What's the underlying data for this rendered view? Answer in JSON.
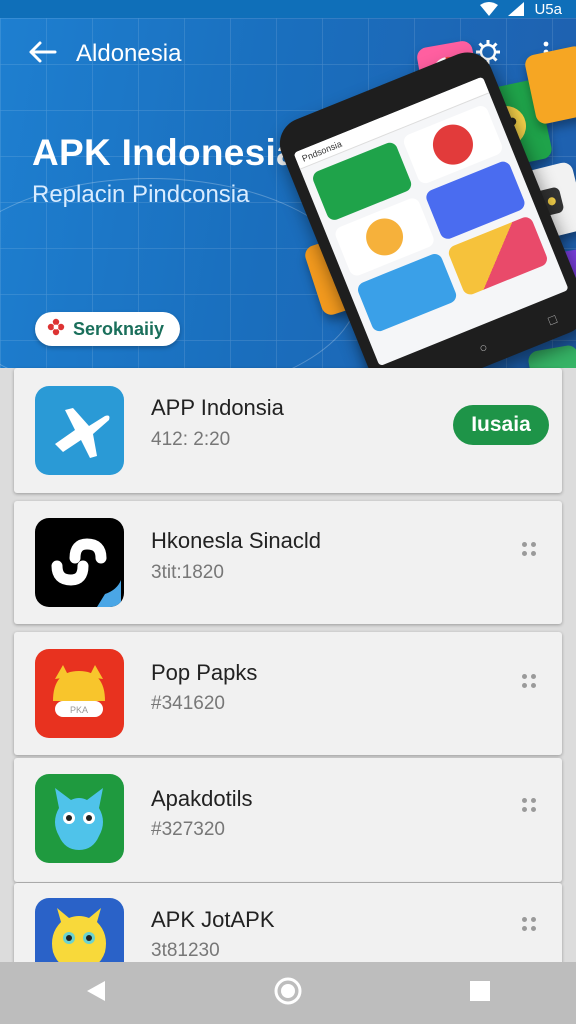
{
  "status_bar": {
    "carrier_text": "U5a"
  },
  "appbar": {
    "title": "Aldonesia"
  },
  "hero": {
    "title": "APK Indonesia",
    "subtitle": "Replacin Pindconsia",
    "chip_label": "Seroknaiiy",
    "phone_header": "Pndsonsia"
  },
  "apps": [
    {
      "name": "APP Indonsia",
      "meta": "412: 2:20",
      "action": "Iusaia",
      "icon": "airplane-icon"
    },
    {
      "name": "Hkonesla Sinacld",
      "meta": "3tit:1820",
      "action": "",
      "icon": "swirl-logo-icon"
    },
    {
      "name": "Pop Papks",
      "meta": "#341620",
      "action": "",
      "icon": "cat-face-icon"
    },
    {
      "name": "Apakdotils",
      "meta": "#327320",
      "action": "",
      "icon": "blue-cat-icon"
    },
    {
      "name": "APK JotAPK",
      "meta": "3t81230",
      "action": "",
      "icon": "yellow-monster-icon"
    }
  ],
  "colors": {
    "hero_bg": "#1b73c4",
    "install_green": "#1e9448",
    "card_bg": "#f1f1f1",
    "navbar_bg": "#bdbdbd"
  }
}
